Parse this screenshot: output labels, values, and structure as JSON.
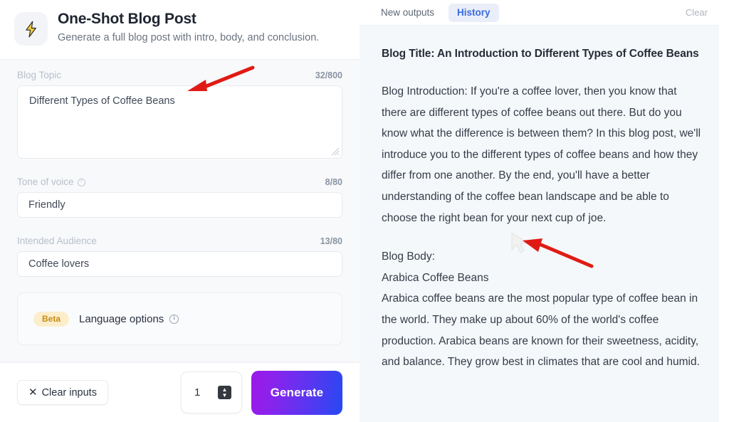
{
  "app": {
    "icon": "lightning-bolt-icon",
    "title": "One-Shot Blog Post",
    "subtitle": "Generate a full blog post with intro, body, and conclusion."
  },
  "form": {
    "blog_topic": {
      "label": "Blog Topic",
      "counter": "32/800",
      "value": "Different Types of Coffee Beans"
    },
    "tone_of_voice": {
      "label": "Tone of voice",
      "counter": "8/80",
      "value": "Friendly"
    },
    "intended_audience": {
      "label": "Intended Audience",
      "counter": "13/80",
      "value": "Coffee lovers"
    },
    "language_options": {
      "badge": "Beta",
      "label": "Language options"
    }
  },
  "footer": {
    "clear_inputs_label": "Clear inputs",
    "clear_inputs_glyph": "✕",
    "quantity_value": "1",
    "stepper_up": "▲",
    "stepper_down": "▼",
    "generate_label": "Generate"
  },
  "output_panel": {
    "tabs": [
      {
        "label": "New outputs",
        "active": false
      },
      {
        "label": "History",
        "active": true
      }
    ],
    "clear_label": "Clear",
    "title": "Blog Title: An Introduction to Different Types of Coffee Beans",
    "introduction": "Blog Introduction: If you're a coffee lover, then you know that there are different types of coffee beans out there. But do you know what the difference is between them? In this blog post, we'll introduce you to the different types of coffee beans and how they differ from one another. By the end, you'll have a better understanding of the coffee bean landscape and be able to choose the right bean for your next cup of joe.",
    "body_heading": "Blog Body:",
    "body_subheading": "Arabica Coffee Beans",
    "body_text": "Arabica coffee beans are the most popular type of coffee bean in the world. They make up about 60% of the world's coffee production. Arabica beans are known for their sweetness, acidity, and balance. They grow best in climates that are cool and humid."
  },
  "scrollbar": {
    "up_glyph": "∧",
    "down_glyph": "∨"
  },
  "colors": {
    "accent_blue": "#3b6ae1",
    "generate_gradient_start": "#9b18e8",
    "generate_gradient_end": "#2649f2",
    "beta_badge_bg": "#fdeecb",
    "beta_badge_text": "#c58c16",
    "annotation_red": "#e01b15"
  }
}
